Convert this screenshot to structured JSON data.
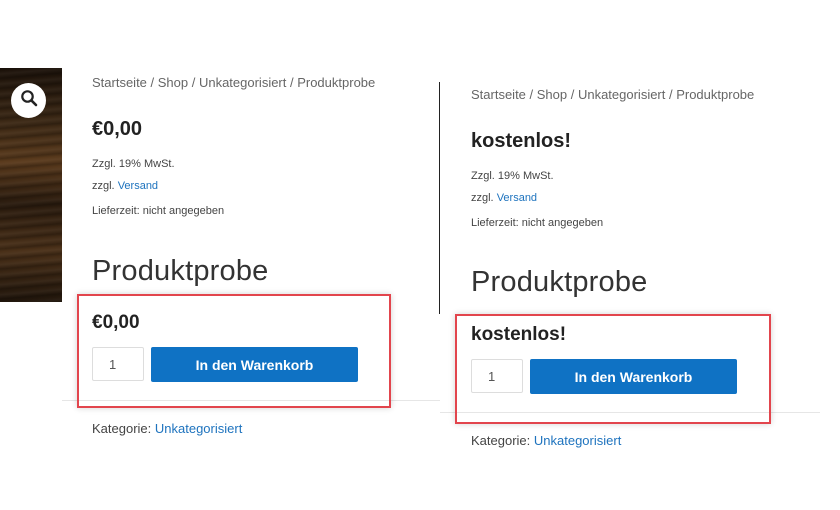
{
  "colors": {
    "accent_blue": "#0f72c4",
    "link_blue": "#1e73be",
    "highlight_red": "#e2454d"
  },
  "left": {
    "breadcrumb": "Startseite / Shop / Unkategorisiert / Produktprobe",
    "price_top": "€0,00",
    "tax_note": "Zzgl. 19% MwSt.",
    "shipping_prefix": "zzgl.",
    "shipping_link": "Versand",
    "delivery_time": "Lieferzeit: nicht angegeben",
    "title": "Produktprobe",
    "price_bottom": "€0,00",
    "quantity": "1",
    "add_to_cart": "In den Warenkorb",
    "category_label": "Kategorie:",
    "category_link": "Unkategorisiert",
    "zoom_icon": "search-icon"
  },
  "right": {
    "breadcrumb": "Startseite / Shop / Unkategorisiert / Produktprobe",
    "price_top": "kostenlos!",
    "tax_note": "Zzgl. 19% MwSt.",
    "shipping_prefix": "zzgl.",
    "shipping_link": "Versand",
    "delivery_time": "Lieferzeit: nicht angegeben",
    "title": "Produktprobe",
    "price_bottom": "kostenlos!",
    "quantity": "1",
    "add_to_cart": "In den Warenkorb",
    "category_label": "Kategorie:",
    "category_link": "Unkategorisiert"
  }
}
